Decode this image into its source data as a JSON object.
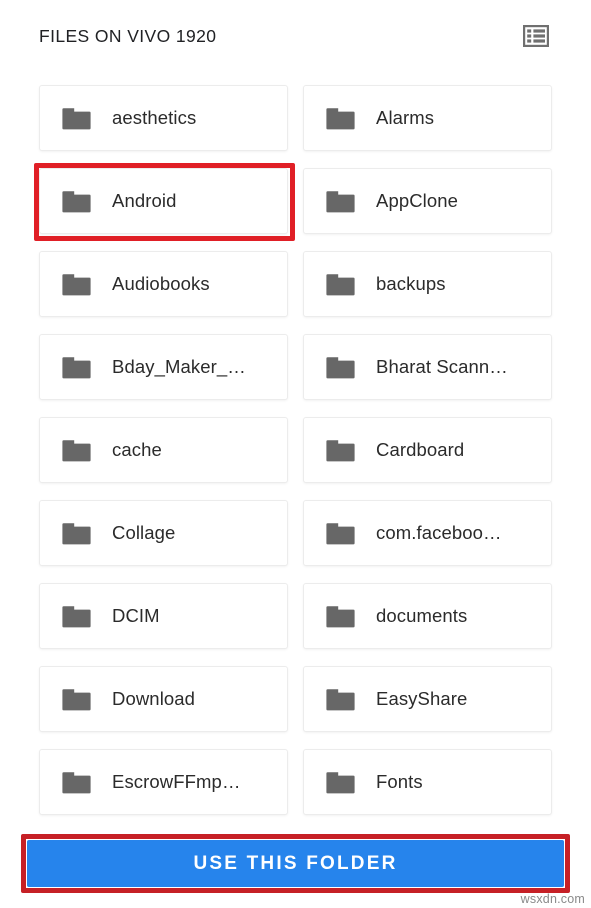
{
  "header": {
    "title": "FILES ON VIVO 1920",
    "view_toggle_icon": "view-list-icon"
  },
  "folders": [
    {
      "name": "aesthetics",
      "icon": "folder-icon",
      "highlighted": false
    },
    {
      "name": "Alarms",
      "icon": "folder-icon",
      "highlighted": false
    },
    {
      "name": "Android",
      "icon": "folder-icon",
      "highlighted": true
    },
    {
      "name": "AppClone",
      "icon": "folder-icon",
      "highlighted": false
    },
    {
      "name": "Audiobooks",
      "icon": "folder-icon",
      "highlighted": false
    },
    {
      "name": "backups",
      "icon": "folder-icon",
      "highlighted": false
    },
    {
      "name": "Bday_Maker_…",
      "icon": "folder-icon",
      "highlighted": false
    },
    {
      "name": "Bharat Scann…",
      "icon": "folder-icon",
      "highlighted": false
    },
    {
      "name": "cache",
      "icon": "folder-icon",
      "highlighted": false
    },
    {
      "name": "Cardboard",
      "icon": "folder-icon",
      "highlighted": false
    },
    {
      "name": "Collage",
      "icon": "folder-icon",
      "highlighted": false
    },
    {
      "name": "com.faceboo…",
      "icon": "folder-icon",
      "highlighted": false
    },
    {
      "name": "DCIM",
      "icon": "folder-icon",
      "highlighted": false
    },
    {
      "name": "documents",
      "icon": "folder-icon",
      "highlighted": false
    },
    {
      "name": "Download",
      "icon": "folder-icon",
      "highlighted": false
    },
    {
      "name": "EasyShare",
      "icon": "folder-icon",
      "highlighted": false
    },
    {
      "name": "EscrowFFmp…",
      "icon": "folder-icon",
      "highlighted": false
    },
    {
      "name": "Fonts",
      "icon": "folder-icon",
      "highlighted": false
    }
  ],
  "footer": {
    "use_folder_label": "USE THIS FOLDER"
  },
  "watermark": {
    "text": "wsxdn.com"
  },
  "colors": {
    "accent_blue": "#2684ec",
    "annotation_red": "#e01f26",
    "folder_gray": "#676767",
    "card_border": "#ececec",
    "text_primary": "#2b2b2b",
    "page_background": "#ffffff"
  }
}
